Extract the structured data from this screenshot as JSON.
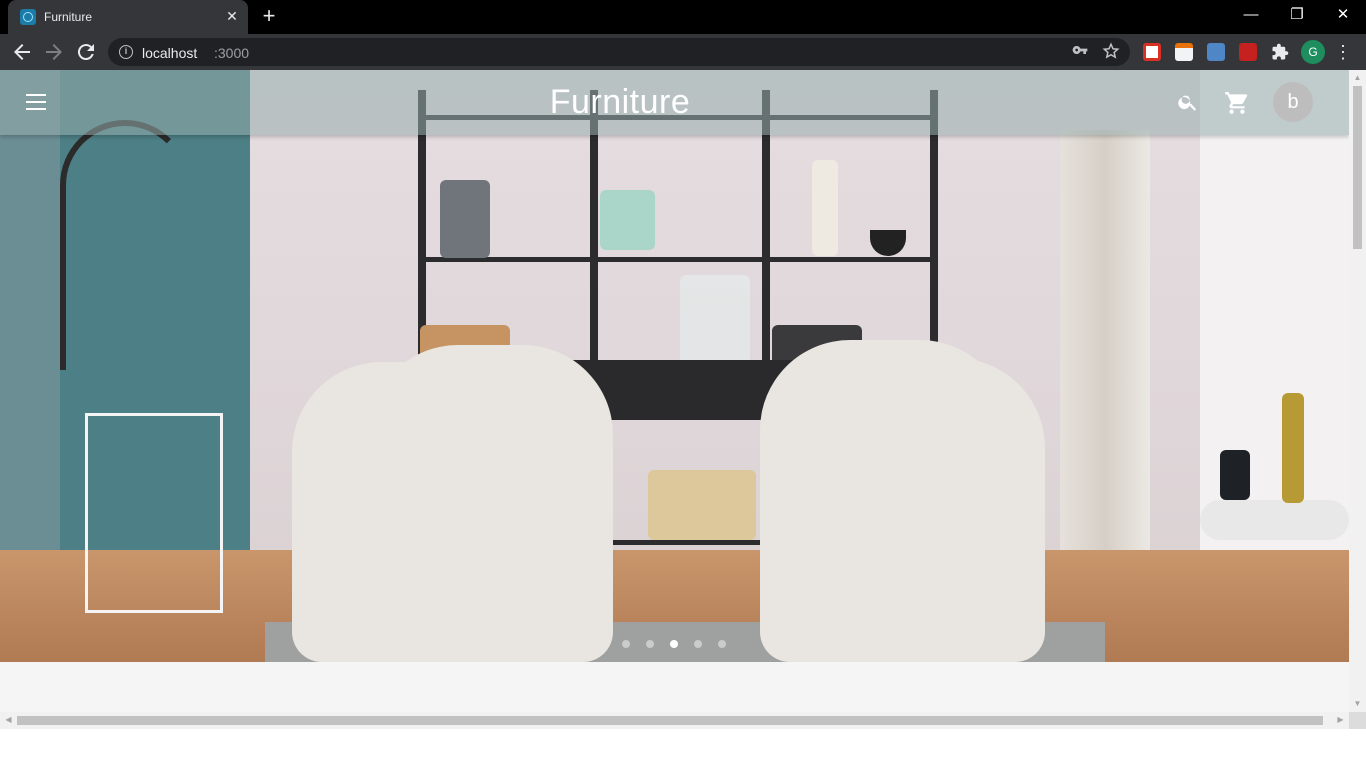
{
  "browser": {
    "tab_title": "Furniture",
    "tab_close": "✕",
    "new_tab": "+",
    "window_controls": {
      "minimize": "—",
      "restore": "❐",
      "close": "✕"
    },
    "url_host": "localhost",
    "url_port": ":3000",
    "profile_initial": "G",
    "icons": [
      "back-icon",
      "forward-icon",
      "reload-icon",
      "info-icon",
      "key-icon",
      "star-icon",
      "extensions-icon",
      "menu-icon"
    ]
  },
  "app": {
    "title": "Furniture",
    "avatar_initial": "b",
    "appbar_color": "#96acac",
    "carousel": {
      "count": 5,
      "active_index": 2
    }
  }
}
